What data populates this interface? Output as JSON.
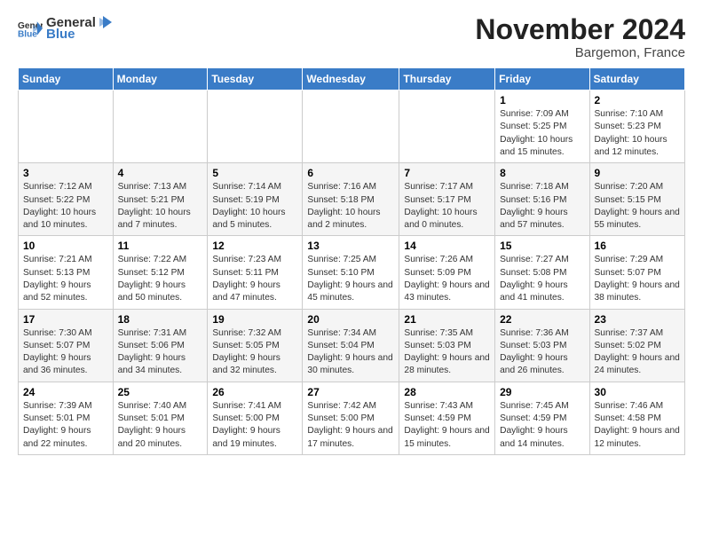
{
  "header": {
    "logo_general": "General",
    "logo_blue": "Blue",
    "month_title": "November 2024",
    "location": "Bargemon, France"
  },
  "calendar": {
    "days_of_week": [
      "Sunday",
      "Monday",
      "Tuesday",
      "Wednesday",
      "Thursday",
      "Friday",
      "Saturday"
    ],
    "weeks": [
      [
        {
          "day": "",
          "info": ""
        },
        {
          "day": "",
          "info": ""
        },
        {
          "day": "",
          "info": ""
        },
        {
          "day": "",
          "info": ""
        },
        {
          "day": "",
          "info": ""
        },
        {
          "day": "1",
          "info": "Sunrise: 7:09 AM\nSunset: 5:25 PM\nDaylight: 10 hours and 15 minutes."
        },
        {
          "day": "2",
          "info": "Sunrise: 7:10 AM\nSunset: 5:23 PM\nDaylight: 10 hours and 12 minutes."
        }
      ],
      [
        {
          "day": "3",
          "info": "Sunrise: 7:12 AM\nSunset: 5:22 PM\nDaylight: 10 hours and 10 minutes."
        },
        {
          "day": "4",
          "info": "Sunrise: 7:13 AM\nSunset: 5:21 PM\nDaylight: 10 hours and 7 minutes."
        },
        {
          "day": "5",
          "info": "Sunrise: 7:14 AM\nSunset: 5:19 PM\nDaylight: 10 hours and 5 minutes."
        },
        {
          "day": "6",
          "info": "Sunrise: 7:16 AM\nSunset: 5:18 PM\nDaylight: 10 hours and 2 minutes."
        },
        {
          "day": "7",
          "info": "Sunrise: 7:17 AM\nSunset: 5:17 PM\nDaylight: 10 hours and 0 minutes."
        },
        {
          "day": "8",
          "info": "Sunrise: 7:18 AM\nSunset: 5:16 PM\nDaylight: 9 hours and 57 minutes."
        },
        {
          "day": "9",
          "info": "Sunrise: 7:20 AM\nSunset: 5:15 PM\nDaylight: 9 hours and 55 minutes."
        }
      ],
      [
        {
          "day": "10",
          "info": "Sunrise: 7:21 AM\nSunset: 5:13 PM\nDaylight: 9 hours and 52 minutes."
        },
        {
          "day": "11",
          "info": "Sunrise: 7:22 AM\nSunset: 5:12 PM\nDaylight: 9 hours and 50 minutes."
        },
        {
          "day": "12",
          "info": "Sunrise: 7:23 AM\nSunset: 5:11 PM\nDaylight: 9 hours and 47 minutes."
        },
        {
          "day": "13",
          "info": "Sunrise: 7:25 AM\nSunset: 5:10 PM\nDaylight: 9 hours and 45 minutes."
        },
        {
          "day": "14",
          "info": "Sunrise: 7:26 AM\nSunset: 5:09 PM\nDaylight: 9 hours and 43 minutes."
        },
        {
          "day": "15",
          "info": "Sunrise: 7:27 AM\nSunset: 5:08 PM\nDaylight: 9 hours and 41 minutes."
        },
        {
          "day": "16",
          "info": "Sunrise: 7:29 AM\nSunset: 5:07 PM\nDaylight: 9 hours and 38 minutes."
        }
      ],
      [
        {
          "day": "17",
          "info": "Sunrise: 7:30 AM\nSunset: 5:07 PM\nDaylight: 9 hours and 36 minutes."
        },
        {
          "day": "18",
          "info": "Sunrise: 7:31 AM\nSunset: 5:06 PM\nDaylight: 9 hours and 34 minutes."
        },
        {
          "day": "19",
          "info": "Sunrise: 7:32 AM\nSunset: 5:05 PM\nDaylight: 9 hours and 32 minutes."
        },
        {
          "day": "20",
          "info": "Sunrise: 7:34 AM\nSunset: 5:04 PM\nDaylight: 9 hours and 30 minutes."
        },
        {
          "day": "21",
          "info": "Sunrise: 7:35 AM\nSunset: 5:03 PM\nDaylight: 9 hours and 28 minutes."
        },
        {
          "day": "22",
          "info": "Sunrise: 7:36 AM\nSunset: 5:03 PM\nDaylight: 9 hours and 26 minutes."
        },
        {
          "day": "23",
          "info": "Sunrise: 7:37 AM\nSunset: 5:02 PM\nDaylight: 9 hours and 24 minutes."
        }
      ],
      [
        {
          "day": "24",
          "info": "Sunrise: 7:39 AM\nSunset: 5:01 PM\nDaylight: 9 hours and 22 minutes."
        },
        {
          "day": "25",
          "info": "Sunrise: 7:40 AM\nSunset: 5:01 PM\nDaylight: 9 hours and 20 minutes."
        },
        {
          "day": "26",
          "info": "Sunrise: 7:41 AM\nSunset: 5:00 PM\nDaylight: 9 hours and 19 minutes."
        },
        {
          "day": "27",
          "info": "Sunrise: 7:42 AM\nSunset: 5:00 PM\nDaylight: 9 hours and 17 minutes."
        },
        {
          "day": "28",
          "info": "Sunrise: 7:43 AM\nSunset: 4:59 PM\nDaylight: 9 hours and 15 minutes."
        },
        {
          "day": "29",
          "info": "Sunrise: 7:45 AM\nSunset: 4:59 PM\nDaylight: 9 hours and 14 minutes."
        },
        {
          "day": "30",
          "info": "Sunrise: 7:46 AM\nSunset: 4:58 PM\nDaylight: 9 hours and 12 minutes."
        }
      ]
    ]
  }
}
